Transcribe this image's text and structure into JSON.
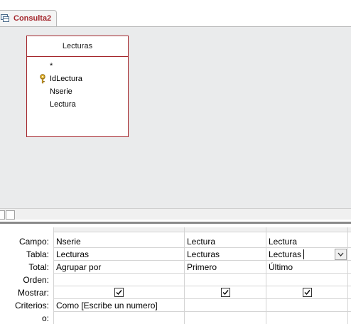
{
  "tab": {
    "label": "Consulta2"
  },
  "table": {
    "title": "Lecturas",
    "fields": [
      "*",
      "IdLectura",
      "Nserie",
      "Lectura"
    ]
  },
  "grid": {
    "row_labels": [
      "Campo:",
      "Tabla:",
      "Total:",
      "Orden:",
      "Mostrar:",
      "Criterios:",
      "o:"
    ],
    "columns": [
      {
        "campo": "Nserie",
        "tabla": "Lecturas",
        "total": "Agrupar por",
        "orden": "",
        "mostrar": true,
        "criterios": "Como [Escribe un numero]"
      },
      {
        "campo": "Lectura",
        "tabla": "Lecturas",
        "total": "Primero",
        "orden": "",
        "mostrar": true,
        "criterios": ""
      },
      {
        "campo": "Lectura",
        "tabla": "Lecturas",
        "total": "Último",
        "orden": "",
        "mostrar": true,
        "criterios": ""
      }
    ]
  },
  "colors": {
    "accent": "#a4262c",
    "surface": "#eaebec"
  },
  "icons": [
    "query-icon",
    "primary-key-icon",
    "checkbox-icon",
    "chevron-down-icon"
  ]
}
